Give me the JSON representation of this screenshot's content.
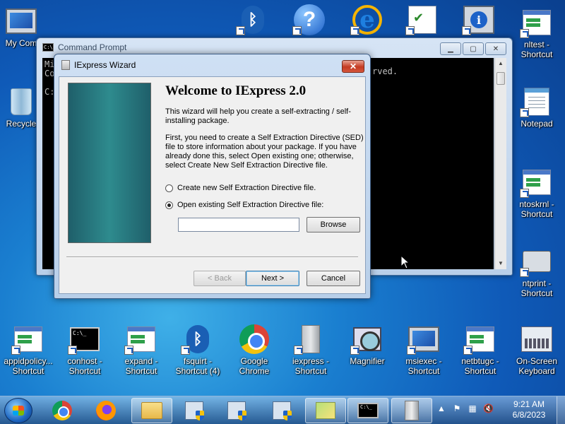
{
  "desktop": {
    "top_icons": [
      {
        "label": "My Com",
        "icon": "computer-icon"
      },
      {
        "label": "",
        "icon": "bluetooth-icon"
      },
      {
        "label": "",
        "icon": "help-icon"
      },
      {
        "label": "",
        "icon": "internet-explorer-icon"
      },
      {
        "label": "",
        "icon": "checklist-icon"
      },
      {
        "label": "",
        "icon": "info-monitor-icon"
      },
      {
        "label": "nltest -\nShortcut",
        "icon": "window-icon"
      }
    ],
    "left_icons": [
      {
        "label": "Recycle",
        "icon": "recycle-bin-icon"
      }
    ],
    "right_icons": [
      {
        "label": "Notepad",
        "icon": "notepad-icon"
      },
      {
        "label": "ntoskrnl -\nShortcut",
        "icon": "window-icon"
      },
      {
        "label": "ntprint -\nShortcut",
        "icon": "printer-icon"
      }
    ],
    "bottom_icons": [
      {
        "label": "appidpolicy...\nShortcut",
        "icon": "window-icon"
      },
      {
        "label": "conhost -\nShortcut",
        "icon": "console-icon"
      },
      {
        "label": "expand -\nShortcut",
        "icon": "window-icon"
      },
      {
        "label": "fsquirt -\nShortcut (4)",
        "icon": "bluetooth-icon"
      },
      {
        "label": "Google\nChrome",
        "icon": "chrome-icon"
      },
      {
        "label": "iexpress -\nShortcut",
        "icon": "tower-icon"
      },
      {
        "label": "Magnifier",
        "icon": "magnifier-icon"
      },
      {
        "label": "msiexec -\nShortcut",
        "icon": "installer-icon"
      },
      {
        "label": "netbtugc -\nShortcut",
        "icon": "window-icon"
      },
      {
        "label": "On-Screen\nKeyboard",
        "icon": "keyboard-icon"
      }
    ]
  },
  "cmd_window": {
    "title": "Command Prompt",
    "console_lines": [
      "Mi",
      "Co",
      "",
      "C:"
    ],
    "console_tail": "rved.",
    "buttons": {
      "minimize": "▁",
      "maximize": "▢",
      "close": "✕"
    }
  },
  "wizard": {
    "title": "IExpress Wizard",
    "heading": "Welcome to IExpress 2.0",
    "intro": "This wizard will help you create a self-extracting / self-installing package.",
    "instructions": "First, you need to create a Self Extraction Directive (SED) file to store information about your package.  If you have already done this, select Open existing one; otherwise, select Create New Self Extraction Directive file.",
    "option_create": "Create new Self Extraction Directive file.",
    "option_open": "Open existing Self Extraction Directive file:",
    "selected_option": "open",
    "path_value": "",
    "browse_label": "Browse",
    "back_label": "< Back",
    "next_label": "Next >",
    "cancel_label": "Cancel",
    "close_label": "✕",
    "banner_color": "#2e8b8e"
  },
  "taskbar": {
    "clock_time": "9:21 AM",
    "clock_date": "6/8/2023",
    "tray_arrow": "▲"
  }
}
